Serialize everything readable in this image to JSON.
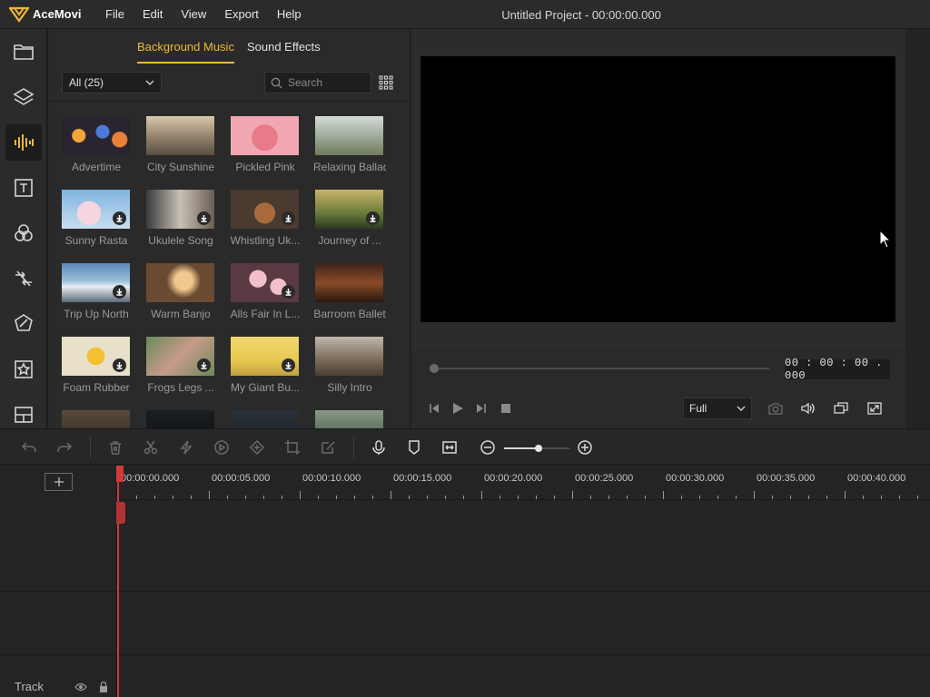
{
  "app": {
    "name": "AceMovi",
    "window_title": "Untitled Project - 00:00:00.000",
    "menu": [
      "File",
      "Edit",
      "View",
      "Export",
      "Help"
    ]
  },
  "sidebar": {
    "items": [
      {
        "name": "folder-icon",
        "active": false
      },
      {
        "name": "layers-icon",
        "active": false
      },
      {
        "name": "audio-icon",
        "active": true
      },
      {
        "name": "text-icon",
        "active": false
      },
      {
        "name": "filters-icon",
        "active": false
      },
      {
        "name": "transitions-icon",
        "active": false
      },
      {
        "name": "effects-icon",
        "active": false
      },
      {
        "name": "elements-icon",
        "active": false
      },
      {
        "name": "split-screen-icon",
        "active": false
      }
    ]
  },
  "media": {
    "tabs": [
      {
        "label": "Background Music",
        "active": true
      },
      {
        "label": "Sound Effects",
        "active": false
      }
    ],
    "filter_value": "All (25)",
    "search_placeholder": "Search",
    "items": [
      {
        "label": "Advertime",
        "download": false
      },
      {
        "label": "City Sunshine",
        "download": false
      },
      {
        "label": "Pickled Pink",
        "download": false
      },
      {
        "label": "Relaxing Ballad",
        "download": false
      },
      {
        "label": "Sunny Rasta",
        "download": true
      },
      {
        "label": "Ukulele Song",
        "download": true
      },
      {
        "label": "Whistling Uk...",
        "download": true
      },
      {
        "label": "Journey of ...",
        "download": true
      },
      {
        "label": "Trip Up North",
        "download": true
      },
      {
        "label": "Warm Banjo",
        "download": false
      },
      {
        "label": "Alls Fair In L...",
        "download": true
      },
      {
        "label": "Barroom Ballet",
        "download": false
      },
      {
        "label": "Foam Rubber",
        "download": true
      },
      {
        "label": "Frogs Legs ...",
        "download": true
      },
      {
        "label": "My Giant Bu...",
        "download": true
      },
      {
        "label": "Silly Intro",
        "download": false
      },
      {
        "label": "",
        "download": false
      },
      {
        "label": "",
        "download": false
      },
      {
        "label": "",
        "download": false
      },
      {
        "label": "",
        "download": false
      }
    ]
  },
  "player": {
    "timecode": "00 : 00 : 00 . 000",
    "quality": "Full"
  },
  "timeline": {
    "ruler_labels": [
      "00:00:00.000",
      "00:00:05.000",
      "00:00:10.000",
      "00:00:15.000",
      "00:00:20.000",
      "00:00:25.000",
      "00:00:30.000",
      "00:00:35.000",
      "00:00:40.000"
    ],
    "track_label": "Track"
  },
  "colors": {
    "accent": "#f0b73a",
    "playhead": "#d03a3a"
  }
}
